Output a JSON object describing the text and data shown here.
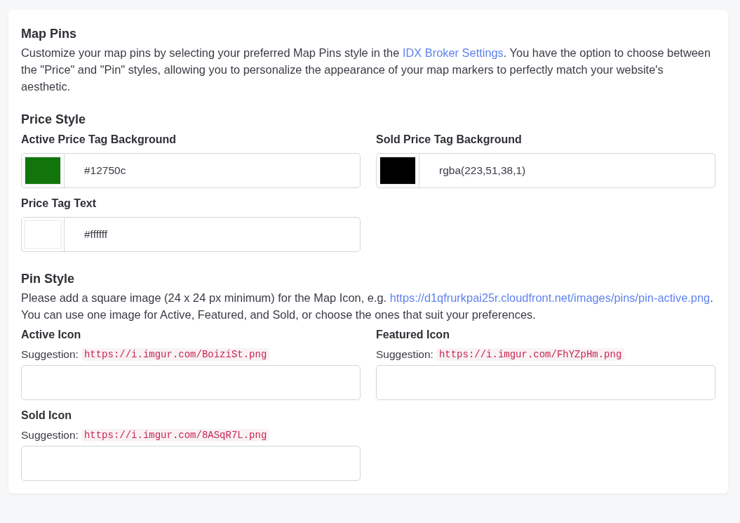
{
  "map_pins": {
    "title": "Map Pins",
    "description": [
      {
        "kind": "text",
        "text": "Customize your map pins by selecting your preferred Map Pins style in the "
      },
      {
        "kind": "link",
        "text": "IDX Broker Settings"
      },
      {
        "kind": "text",
        "text": ". You have the option to choose between the \"Price\" and \"Pin\" styles, allowing you to personalize the appearance of your map markers to perfectly match your website's aesthetic."
      }
    ]
  },
  "price_style": {
    "title": "Price Style",
    "fields": [
      {
        "label": "Active Price Tag Background",
        "value": "#12750c",
        "color": "#12750c"
      },
      {
        "label": "Sold Price Tag Background",
        "value": "rgba(223,51,38,1)",
        "color": "#000000"
      },
      {
        "label": "Price Tag Text",
        "value": "#ffffff",
        "color": "#ffffff"
      }
    ]
  },
  "pin_style": {
    "title": "Pin Style",
    "description": [
      {
        "kind": "text",
        "text": "Please add a square image (24 x 24 px minimum) for the Map Icon, e.g. "
      },
      {
        "kind": "link",
        "text": "https://d1qfrurkpai25r.cloudfront.net/images/pins/pin-active.png"
      },
      {
        "kind": "text",
        "text": ". You can use one image for Active, Featured, and Sold, or choose the ones that suit your preferences."
      }
    ],
    "fields": [
      {
        "label": "Active Icon",
        "hint": "Suggestion:",
        "suggestion": "https://i.imgur.com/BoiziSt.png"
      },
      {
        "label": "Featured Icon",
        "hint": "Suggestion:",
        "suggestion": "https://i.imgur.com/FhYZpHm.png"
      },
      {
        "label": "Sold Icon",
        "hint": "Suggestion:",
        "suggestion": "https://i.imgur.com/8ASqR7L.png"
      }
    ]
  }
}
